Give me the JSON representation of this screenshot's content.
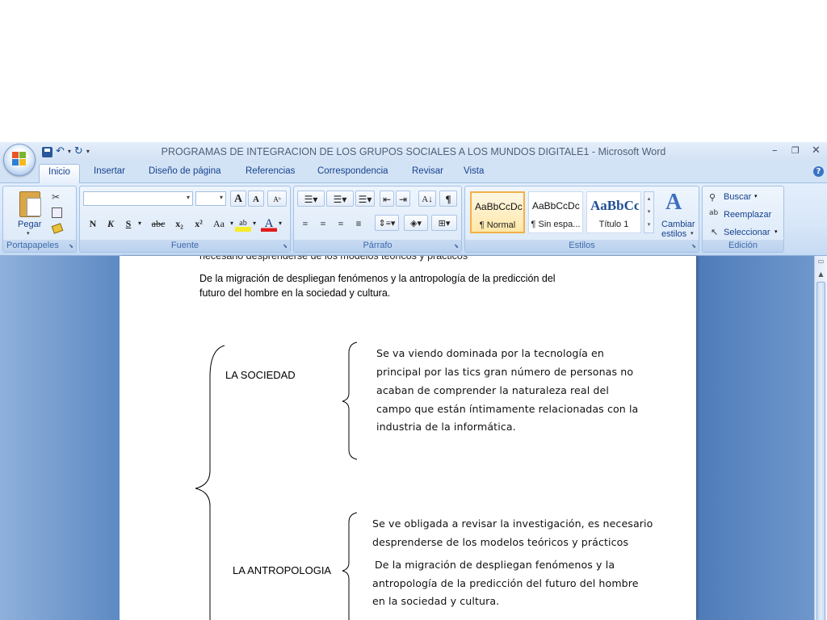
{
  "window": {
    "title": "PROGRAMAS DE INTEGRACION DE LOS GRUPOS SOCIALES A LOS MUNDOS DIGITALE1 - Microsoft Word",
    "minimize": "–",
    "restore": "❐",
    "close": "✕"
  },
  "qat": {
    "undo": "↶",
    "redo": "↻",
    "customize": "▾"
  },
  "tabs": [
    "Inicio",
    "Insertar",
    "Diseño de página",
    "Referencias",
    "Correspondencia",
    "Revisar",
    "Vista"
  ],
  "ribbon": {
    "clipboard": {
      "label": "Portapapeles",
      "paste": "Pegar"
    },
    "font": {
      "label": "Fuente",
      "bold": "N",
      "italic": "K",
      "underline": "S",
      "strike": "abc",
      "subscript": "x₂",
      "superscript": "x²",
      "case": "Aa",
      "grow": "A",
      "shrink": "A",
      "highlight": "ab",
      "color": "A"
    },
    "paragraph": {
      "label": "Párrafo",
      "pilcrow": "¶"
    },
    "styles": {
      "label": "Estilos",
      "items": [
        {
          "sample": "AaBbCcDc",
          "name": "¶ Normal"
        },
        {
          "sample": "AaBbCcDc",
          "name": "¶ Sin espa..."
        },
        {
          "sample": "AaBbCc",
          "name": "Título 1"
        }
      ],
      "change_line1": "Cambiar",
      "change_line2": "estilos"
    },
    "editing": {
      "label": "Edición",
      "find": "Buscar",
      "replace": "Reemplazar",
      "select": "Seleccionar"
    }
  },
  "document": {
    "cut_line": "necesario desprenderse de los modelos teóricos y prácticos",
    "para_line1": " De la migración de despliegan fenómenos y la antropología de la predicción del",
    "para_line2": "futuro del hombre en la sociedad y cultura.",
    "label_sociedad": "LA SOCIEDAD",
    "sociedad_lines": [
      "Se va viendo dominada por la tecnología en",
      "principal por las tics gran número de personas no",
      "acaban de comprender la naturaleza real del",
      "campo que están íntimamente relacionadas con la",
      "industria de la informática."
    ],
    "label_antropologia": "LA ANTROPOLOGIA",
    "antro_lines_a": [
      "Se ve obligada a revisar la investigación, es necesario",
      "desprenderse de los modelos teóricos y prácticos"
    ],
    "antro_lines_b": [
      "De la migración de despliegan fenómenos y la",
      "antropología de la predicción del futuro del hombre",
      "en la sociedad y cultura."
    ]
  }
}
